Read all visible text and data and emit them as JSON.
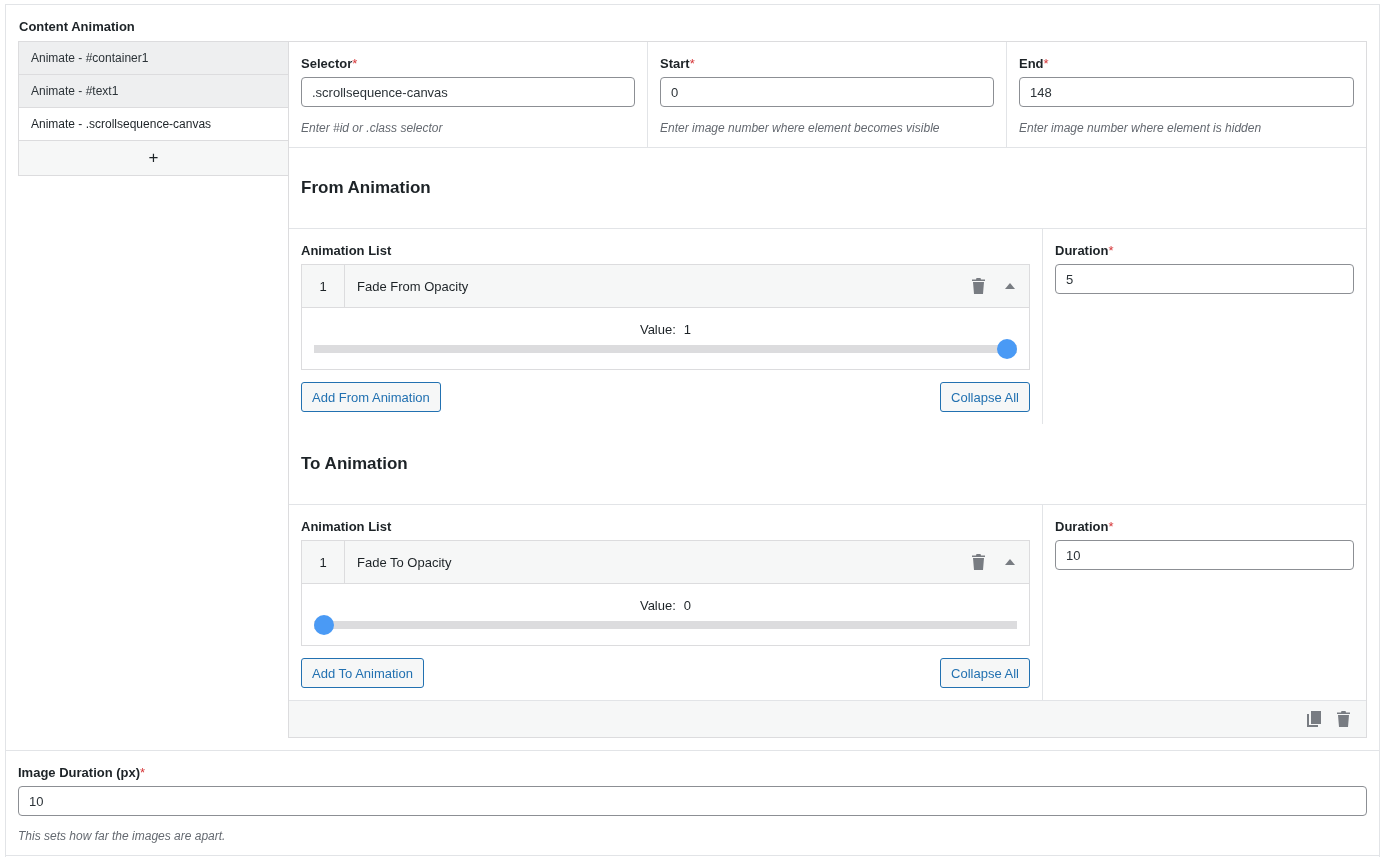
{
  "section_title": "Content Animation",
  "sidebar": {
    "items": [
      {
        "label": "Animate - #container1",
        "selected": false
      },
      {
        "label": "Animate - #text1",
        "selected": false
      },
      {
        "label": "Animate - .scrollsequence-canvas",
        "selected": true
      }
    ],
    "add_button": "+"
  },
  "fields": [
    {
      "label": "Selector",
      "required_mark": "*",
      "value": ".scrollsequence-canvas",
      "help": "Enter #id or .class selector"
    },
    {
      "label": "Start",
      "required_mark": "*",
      "value": "0",
      "help": "Enter image number where element becomes visible"
    },
    {
      "label": "End",
      "required_mark": "*",
      "value": "148",
      "help": "Enter image number where element is hidden"
    }
  ],
  "animations": [
    {
      "title": "From Animation",
      "list_label": "Animation List",
      "items": [
        {
          "number": "1",
          "name": "Fade From Opacity",
          "expanded": true,
          "value_label": "Value:",
          "value": "1",
          "level": 1
        }
      ],
      "add_button": "Add From Animation",
      "collapse_button": "Collapse All",
      "duration": {
        "label": "Duration",
        "required_mark": "*",
        "value": "5"
      }
    },
    {
      "title": "To Animation",
      "list_label": "Animation List",
      "items": [
        {
          "number": "1",
          "name": "Fade To Opacity",
          "expanded": true,
          "value_label": "Value:",
          "value": "0",
          "level": 0
        }
      ],
      "add_button": "Add To Animation",
      "collapse_button": "Collapse All",
      "duration": {
        "label": "Duration",
        "required_mark": "*",
        "value": "10"
      }
    }
  ],
  "image_duration": {
    "label": "Image Duration (px)",
    "required_mark": "*",
    "value": "10",
    "help": "This sets how far the images are apart."
  }
}
